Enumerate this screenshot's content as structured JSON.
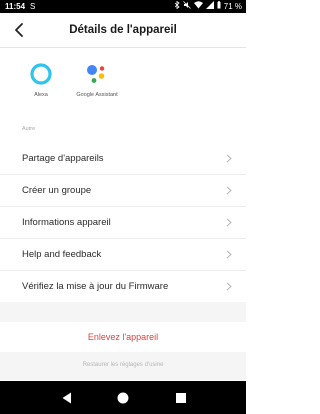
{
  "status_bar": {
    "time": "11:54",
    "app_indicator": "S",
    "icons": [
      "bluetooth-icon",
      "mute-icon",
      "wifi-icon",
      "signal-icon"
    ],
    "battery": "71 %"
  },
  "header": {
    "title": "Détails de l'appareil",
    "back_icon": "chevron-left-icon"
  },
  "services": [
    {
      "label": "Alexa",
      "icon": "alexa-icon",
      "color": "#2ec4ef"
    },
    {
      "label": "Google Assistant",
      "icon": "google-assistant-icon",
      "colors": [
        "#4285f4",
        "#ea4335",
        "#fbbc05",
        "#34a853"
      ]
    }
  ],
  "section_label": "Autre",
  "menu": [
    {
      "label": "Partage d'appareils"
    },
    {
      "label": "Créer un groupe"
    },
    {
      "label": "Informations appareil"
    },
    {
      "label": "Help and feedback"
    },
    {
      "label": "Vérifiez la mise à jour du Firmware"
    }
  ],
  "remove_button": "Enlevez l'appareil",
  "restore_link": "Restaurer les réglages d'usine",
  "nav": {
    "back": "back-triangle-icon",
    "home": "home-circle-icon",
    "recent": "recent-square-icon"
  },
  "colors": {
    "accent_red": "#e0413c",
    "background_gray": "#f5f5f5"
  }
}
